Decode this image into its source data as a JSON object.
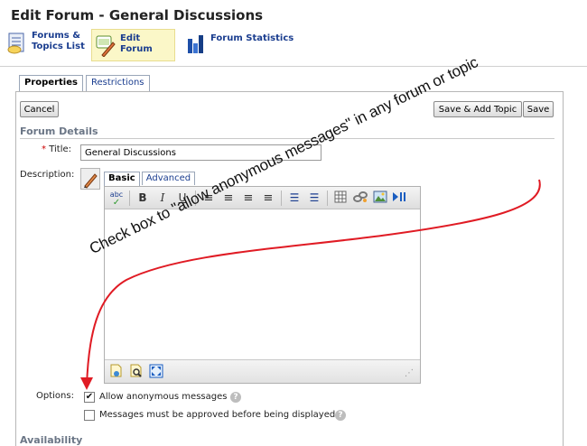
{
  "page": {
    "title": "Edit Forum - General Discussions"
  },
  "nav": {
    "items": [
      {
        "label_line1": "Forums &",
        "label_line2": "Topics List",
        "icon": "forums-list-icon"
      },
      {
        "label": "Edit Forum",
        "icon": "edit-forum-icon"
      },
      {
        "label": "Forum Statistics",
        "icon": "bar-chart-icon"
      }
    ]
  },
  "tabs": {
    "properties": "Properties",
    "restrictions": "Restrictions"
  },
  "buttons": {
    "cancel": "Cancel",
    "save_add_topic": "Save & Add Topic",
    "save": "Save"
  },
  "forum_details": {
    "heading": "Forum Details",
    "title_label": "Title:",
    "required_mark": "*",
    "title_value": "General Discussions",
    "description_label": "Description:"
  },
  "editor": {
    "tabs": {
      "basic": "Basic",
      "advanced": "Advanced"
    },
    "toolbar": {
      "spellcheck": "abc",
      "bold": "B",
      "italic": "I",
      "underline": "U"
    }
  },
  "options": {
    "label": "Options:",
    "allow_anonymous": {
      "label": "Allow anonymous messages",
      "checked": true
    },
    "require_approval": {
      "label": "Messages must be approved before being displayed",
      "checked": false
    }
  },
  "availability": {
    "heading": "Availability"
  },
  "annotation": {
    "text": "Check box to \"allow anonymous messages\" in any forum or topic",
    "arrow_color": "#e01b24"
  },
  "colors": {
    "link": "#1a3d8f",
    "section_heading": "#6b7686",
    "required": "#cc0000",
    "selected_nav_bg": "#fbf7c8"
  }
}
